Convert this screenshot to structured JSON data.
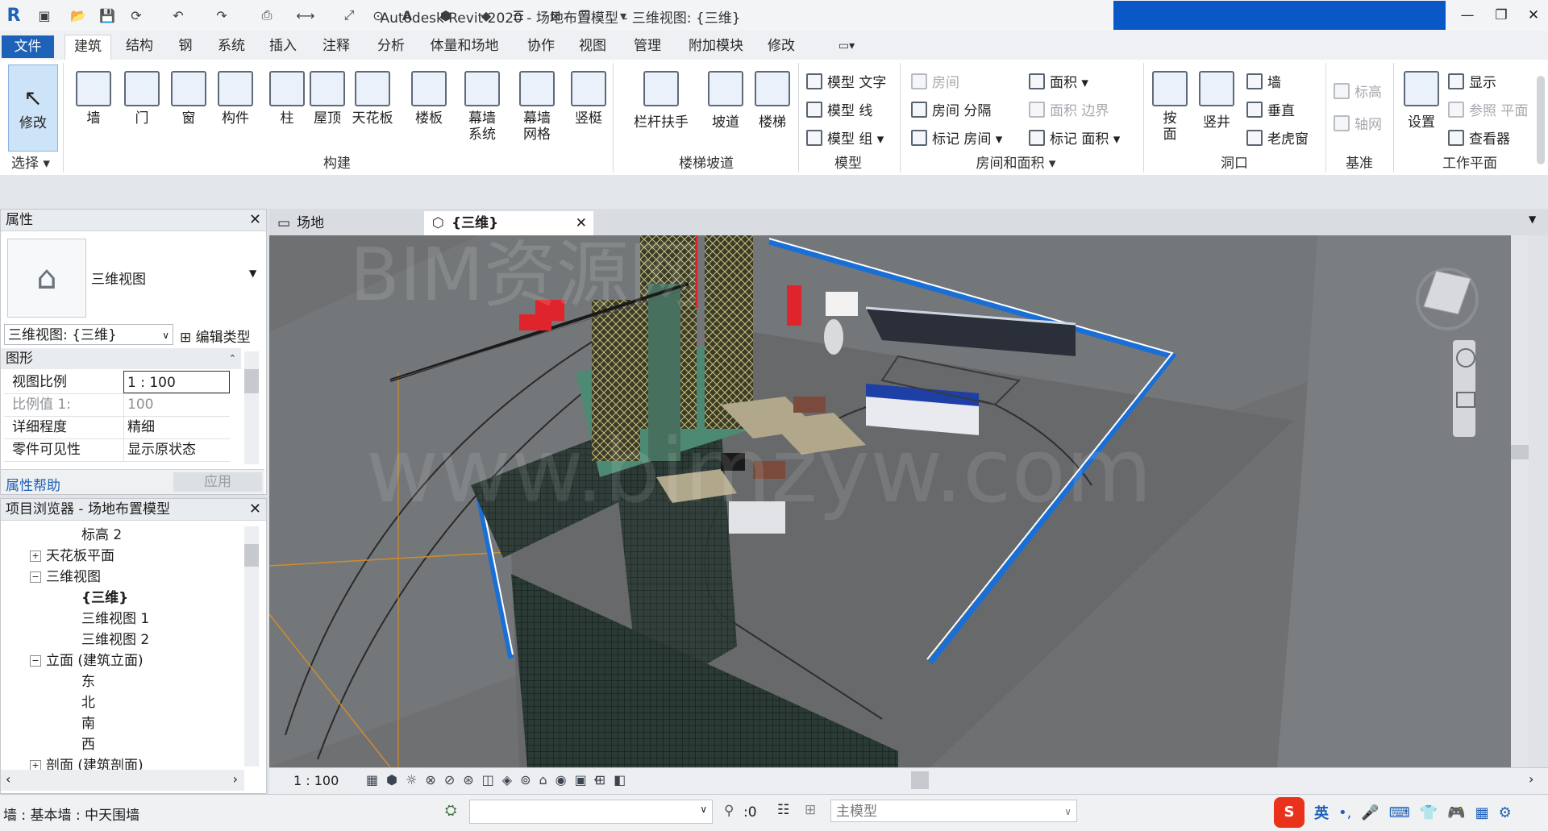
{
  "app": {
    "title": "Autodesk Revit 2020 - 场地布置模型 - 三维视图: {三维}",
    "logo": "R"
  },
  "tabs": [
    "文件",
    "建筑",
    "结构",
    "钢",
    "系统",
    "插入",
    "注释",
    "分析",
    "体量和场地",
    "协作",
    "视图",
    "管理",
    "附加模块",
    "修改"
  ],
  "ribbon": {
    "select": {
      "modify_label": "修改",
      "group_label": "选择 ▾"
    },
    "build": {
      "buttons": [
        "墙",
        "门",
        "窗",
        "构件",
        "柱",
        "屋顶",
        "天花板",
        "楼板",
        "幕墙\n系统",
        "幕墙\n网格",
        "竖梃"
      ],
      "group_label": "构建"
    },
    "stairs": {
      "buttons": [
        "栏杆扶手",
        "坡道",
        "楼梯"
      ],
      "group_label": "楼梯坡道"
    },
    "model": {
      "items": [
        "模型 文字",
        "模型 线",
        "模型 组 ▾"
      ],
      "group_label": "模型"
    },
    "room": {
      "left": [
        "房间",
        "房间 分隔",
        "标记 房间 ▾"
      ],
      "right": [
        "面积 ▾",
        "面积 边界",
        "标记 面积 ▾"
      ],
      "group_label": "房间和面积 ▾"
    },
    "opening": {
      "buttons": [
        "按\n面",
        "竖井"
      ],
      "items": [
        "墙",
        "垂直",
        "老虎窗"
      ],
      "group_label": "洞口"
    },
    "datum": {
      "items": [
        "标高",
        "轴网"
      ],
      "group_label": "基准"
    },
    "workplane": {
      "button": "设置",
      "items": [
        "显示",
        "参照 平面",
        "查看器"
      ],
      "group_label": "工作平面"
    }
  },
  "properties": {
    "title": "属性",
    "type_name": "三维视图",
    "selector": "三维视图: {三维}",
    "edit_type": "编辑类型",
    "section": "图形",
    "rows": [
      {
        "k": "视图比例",
        "v": "1 : 100"
      },
      {
        "k": "比例值 1:",
        "v": "100"
      },
      {
        "k": "详细程度",
        "v": "精细"
      },
      {
        "k": "零件可见性",
        "v": "显示原状态"
      }
    ],
    "help": "属性帮助",
    "apply": "应用"
  },
  "browser": {
    "title": "项目浏览器 - 场地布置模型",
    "items": [
      {
        "label": "标高 2",
        "level": 2,
        "box": ""
      },
      {
        "label": "天花板平面",
        "level": 1,
        "box": "+"
      },
      {
        "label": "三维视图",
        "level": 1,
        "box": "−"
      },
      {
        "label": "{三维}",
        "level": 2,
        "box": "",
        "bold": true
      },
      {
        "label": "三维视图 1",
        "level": 2,
        "box": ""
      },
      {
        "label": "三维视图 2",
        "level": 2,
        "box": ""
      },
      {
        "label": "立面 (建筑立面)",
        "level": 1,
        "box": "−"
      },
      {
        "label": "东",
        "level": 2,
        "box": ""
      },
      {
        "label": "北",
        "level": 2,
        "box": ""
      },
      {
        "label": "南",
        "level": 2,
        "box": ""
      },
      {
        "label": "西",
        "level": 2,
        "box": ""
      },
      {
        "label": "剖面 (建筑剖面)",
        "level": 1,
        "box": "+"
      }
    ]
  },
  "view_tabs": [
    {
      "label": "场地"
    },
    {
      "label": "{三维}"
    }
  ],
  "viewbar": {
    "scale": "1 : 100"
  },
  "status": {
    "text": "墙 : 基本墙 : 中天围墙",
    "zero": ":0",
    "model": "主模型"
  },
  "ime": [
    "英"
  ],
  "watermark": [
    "BIM资源网",
    "www.bimzyw.com"
  ],
  "colors": {
    "accent": "#1e61b8",
    "title_blue": "#0a58c8",
    "crane": "#e0242b",
    "fence": "#1a6fd6"
  }
}
